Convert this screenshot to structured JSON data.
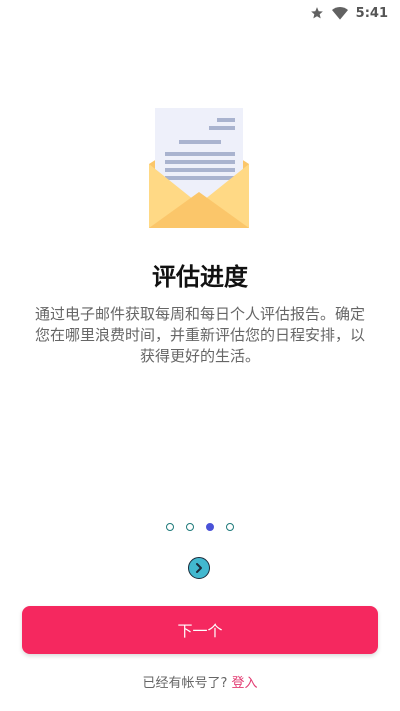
{
  "status_bar": {
    "time": "5:41",
    "icons": [
      "star-icon",
      "wifi-icon"
    ]
  },
  "illustration": {
    "icon": "envelope-letter-icon"
  },
  "onboarding": {
    "title": "评估进度",
    "description": "通过电子邮件获取每周和每日个人评估报告。确定您在哪里浪费时间，并重新评估您的日程安排，以获得更好的生活。",
    "page_index": 3,
    "page_count": 4
  },
  "actions": {
    "next_label": "下一个",
    "have_account_text": "已经有帐号了?",
    "login_label": "登入"
  },
  "colors": {
    "primary": "#f5285f",
    "login_link": "#e23c72",
    "dot_active": "#4a52d8",
    "next_circle": "#42b8cf"
  }
}
